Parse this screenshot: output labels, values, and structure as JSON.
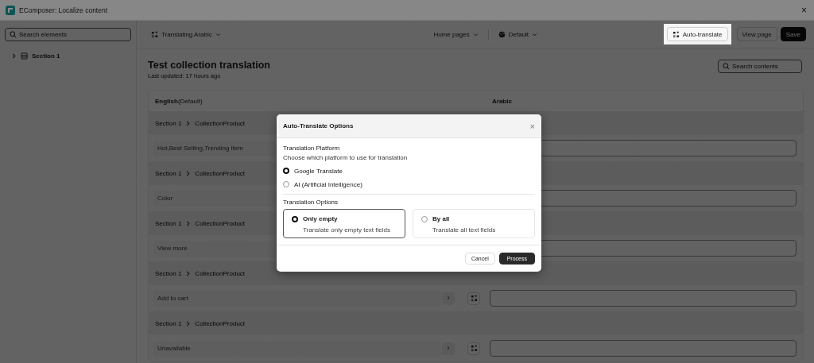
{
  "window": {
    "title": "EComposer: Localize content",
    "close": "×"
  },
  "sidebar": {
    "search": {
      "placeholder": "Search elements"
    },
    "tree": [
      {
        "label": "Section 1",
        "expanded": false
      }
    ]
  },
  "toolbar": {
    "language": "Translating Arabic",
    "page": "Home pages",
    "theme": "Default",
    "buttons": [
      {
        "kind": "auto",
        "label": "Auto-translate",
        "highlighted": true
      },
      {
        "kind": "plain",
        "label": "View page",
        "highlighted": false
      },
      {
        "kind": "primary",
        "label": "Save",
        "highlighted": false
      }
    ]
  },
  "content": {
    "title": "Test collection translation",
    "updated": "Last updated: 17 hours ago",
    "search": {
      "placeholder": "Search contents"
    },
    "columns": [
      "**English**(Default)",
      "Arabic"
    ],
    "rows": [
      {
        "path": [
          "Section 1",
          "CollectionProduct"
        ],
        "source": "Hot,Best Selling,Trending item"
      },
      {
        "path": [
          "Section 1",
          "CollectionProduct"
        ],
        "source": "Color"
      },
      {
        "path": [
          "Section 1",
          "CollectionProduct"
        ],
        "source": "View more"
      },
      {
        "path": [
          "Section 1",
          "CollectionProduct"
        ],
        "source": "Add to cart",
        "expand": "›"
      },
      {
        "path": [
          "Section 1",
          "CollectionProduct"
        ],
        "source": "Unavailable",
        "expand": "›"
      }
    ]
  },
  "dialog": {
    "title": "Auto-Translate Options",
    "close": "×",
    "platform": {
      "label": "Translation Platform",
      "hint": "Choose which platform to use for translation",
      "choices": [
        {
          "label": "Google Translate",
          "selected": true
        },
        {
          "label": "AI (Artificial Intelligence)",
          "selected": false
        }
      ]
    },
    "options": {
      "label": "Translation Options",
      "choices": [
        {
          "title": "Only empty",
          "desc": "Translate only empty text fields",
          "selected": true
        },
        {
          "title": "By all",
          "desc": "Translate all text fields",
          "selected": false
        }
      ]
    },
    "buttons": [
      {
        "kind": "secondary",
        "label": "Cancel"
      },
      {
        "kind": "primary",
        "label": "Process"
      }
    ]
  }
}
